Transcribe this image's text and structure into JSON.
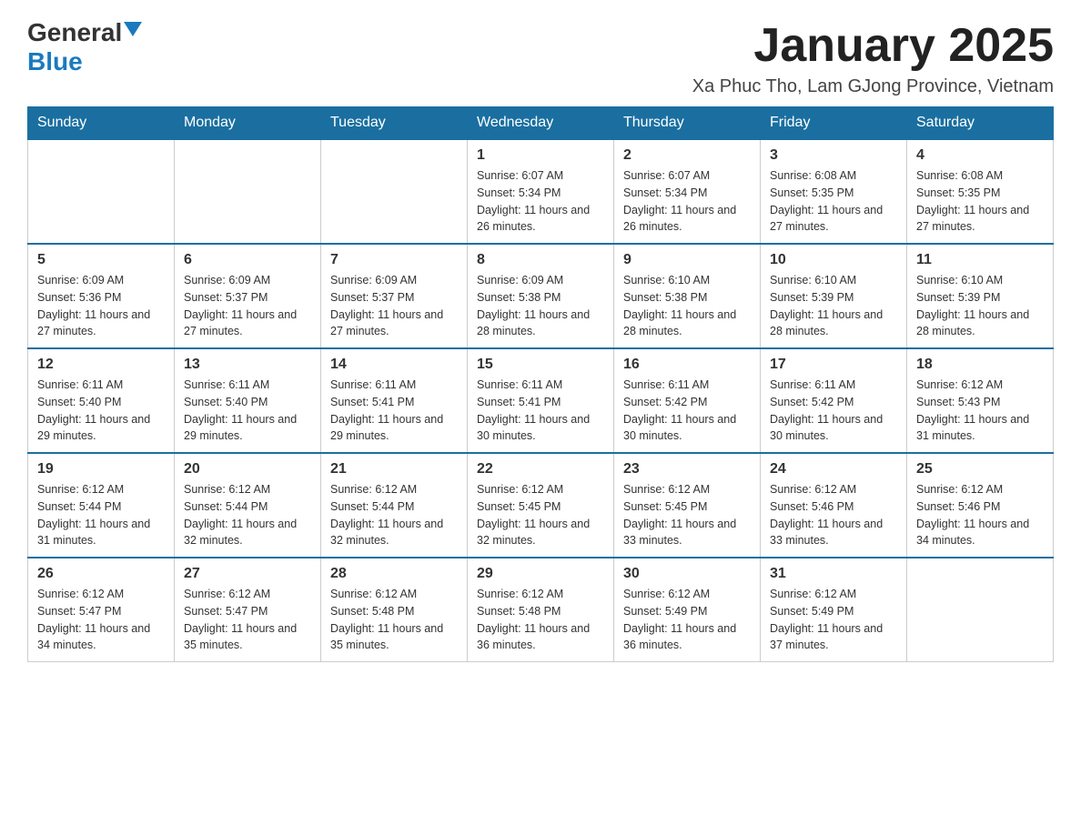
{
  "logo": {
    "general": "General",
    "blue": "Blue"
  },
  "title": "January 2025",
  "location": "Xa Phuc Tho, Lam GJong Province, Vietnam",
  "days_of_week": [
    "Sunday",
    "Monday",
    "Tuesday",
    "Wednesday",
    "Thursday",
    "Friday",
    "Saturday"
  ],
  "weeks": [
    [
      {
        "day": "",
        "info": ""
      },
      {
        "day": "",
        "info": ""
      },
      {
        "day": "",
        "info": ""
      },
      {
        "day": "1",
        "info": "Sunrise: 6:07 AM\nSunset: 5:34 PM\nDaylight: 11 hours and 26 minutes."
      },
      {
        "day": "2",
        "info": "Sunrise: 6:07 AM\nSunset: 5:34 PM\nDaylight: 11 hours and 26 minutes."
      },
      {
        "day": "3",
        "info": "Sunrise: 6:08 AM\nSunset: 5:35 PM\nDaylight: 11 hours and 27 minutes."
      },
      {
        "day": "4",
        "info": "Sunrise: 6:08 AM\nSunset: 5:35 PM\nDaylight: 11 hours and 27 minutes."
      }
    ],
    [
      {
        "day": "5",
        "info": "Sunrise: 6:09 AM\nSunset: 5:36 PM\nDaylight: 11 hours and 27 minutes."
      },
      {
        "day": "6",
        "info": "Sunrise: 6:09 AM\nSunset: 5:37 PM\nDaylight: 11 hours and 27 minutes."
      },
      {
        "day": "7",
        "info": "Sunrise: 6:09 AM\nSunset: 5:37 PM\nDaylight: 11 hours and 27 minutes."
      },
      {
        "day": "8",
        "info": "Sunrise: 6:09 AM\nSunset: 5:38 PM\nDaylight: 11 hours and 28 minutes."
      },
      {
        "day": "9",
        "info": "Sunrise: 6:10 AM\nSunset: 5:38 PM\nDaylight: 11 hours and 28 minutes."
      },
      {
        "day": "10",
        "info": "Sunrise: 6:10 AM\nSunset: 5:39 PM\nDaylight: 11 hours and 28 minutes."
      },
      {
        "day": "11",
        "info": "Sunrise: 6:10 AM\nSunset: 5:39 PM\nDaylight: 11 hours and 28 minutes."
      }
    ],
    [
      {
        "day": "12",
        "info": "Sunrise: 6:11 AM\nSunset: 5:40 PM\nDaylight: 11 hours and 29 minutes."
      },
      {
        "day": "13",
        "info": "Sunrise: 6:11 AM\nSunset: 5:40 PM\nDaylight: 11 hours and 29 minutes."
      },
      {
        "day": "14",
        "info": "Sunrise: 6:11 AM\nSunset: 5:41 PM\nDaylight: 11 hours and 29 minutes."
      },
      {
        "day": "15",
        "info": "Sunrise: 6:11 AM\nSunset: 5:41 PM\nDaylight: 11 hours and 30 minutes."
      },
      {
        "day": "16",
        "info": "Sunrise: 6:11 AM\nSunset: 5:42 PM\nDaylight: 11 hours and 30 minutes."
      },
      {
        "day": "17",
        "info": "Sunrise: 6:11 AM\nSunset: 5:42 PM\nDaylight: 11 hours and 30 minutes."
      },
      {
        "day": "18",
        "info": "Sunrise: 6:12 AM\nSunset: 5:43 PM\nDaylight: 11 hours and 31 minutes."
      }
    ],
    [
      {
        "day": "19",
        "info": "Sunrise: 6:12 AM\nSunset: 5:44 PM\nDaylight: 11 hours and 31 minutes."
      },
      {
        "day": "20",
        "info": "Sunrise: 6:12 AM\nSunset: 5:44 PM\nDaylight: 11 hours and 32 minutes."
      },
      {
        "day": "21",
        "info": "Sunrise: 6:12 AM\nSunset: 5:44 PM\nDaylight: 11 hours and 32 minutes."
      },
      {
        "day": "22",
        "info": "Sunrise: 6:12 AM\nSunset: 5:45 PM\nDaylight: 11 hours and 32 minutes."
      },
      {
        "day": "23",
        "info": "Sunrise: 6:12 AM\nSunset: 5:45 PM\nDaylight: 11 hours and 33 minutes."
      },
      {
        "day": "24",
        "info": "Sunrise: 6:12 AM\nSunset: 5:46 PM\nDaylight: 11 hours and 33 minutes."
      },
      {
        "day": "25",
        "info": "Sunrise: 6:12 AM\nSunset: 5:46 PM\nDaylight: 11 hours and 34 minutes."
      }
    ],
    [
      {
        "day": "26",
        "info": "Sunrise: 6:12 AM\nSunset: 5:47 PM\nDaylight: 11 hours and 34 minutes."
      },
      {
        "day": "27",
        "info": "Sunrise: 6:12 AM\nSunset: 5:47 PM\nDaylight: 11 hours and 35 minutes."
      },
      {
        "day": "28",
        "info": "Sunrise: 6:12 AM\nSunset: 5:48 PM\nDaylight: 11 hours and 35 minutes."
      },
      {
        "day": "29",
        "info": "Sunrise: 6:12 AM\nSunset: 5:48 PM\nDaylight: 11 hours and 36 minutes."
      },
      {
        "day": "30",
        "info": "Sunrise: 6:12 AM\nSunset: 5:49 PM\nDaylight: 11 hours and 36 minutes."
      },
      {
        "day": "31",
        "info": "Sunrise: 6:12 AM\nSunset: 5:49 PM\nDaylight: 11 hours and 37 minutes."
      },
      {
        "day": "",
        "info": ""
      }
    ]
  ]
}
